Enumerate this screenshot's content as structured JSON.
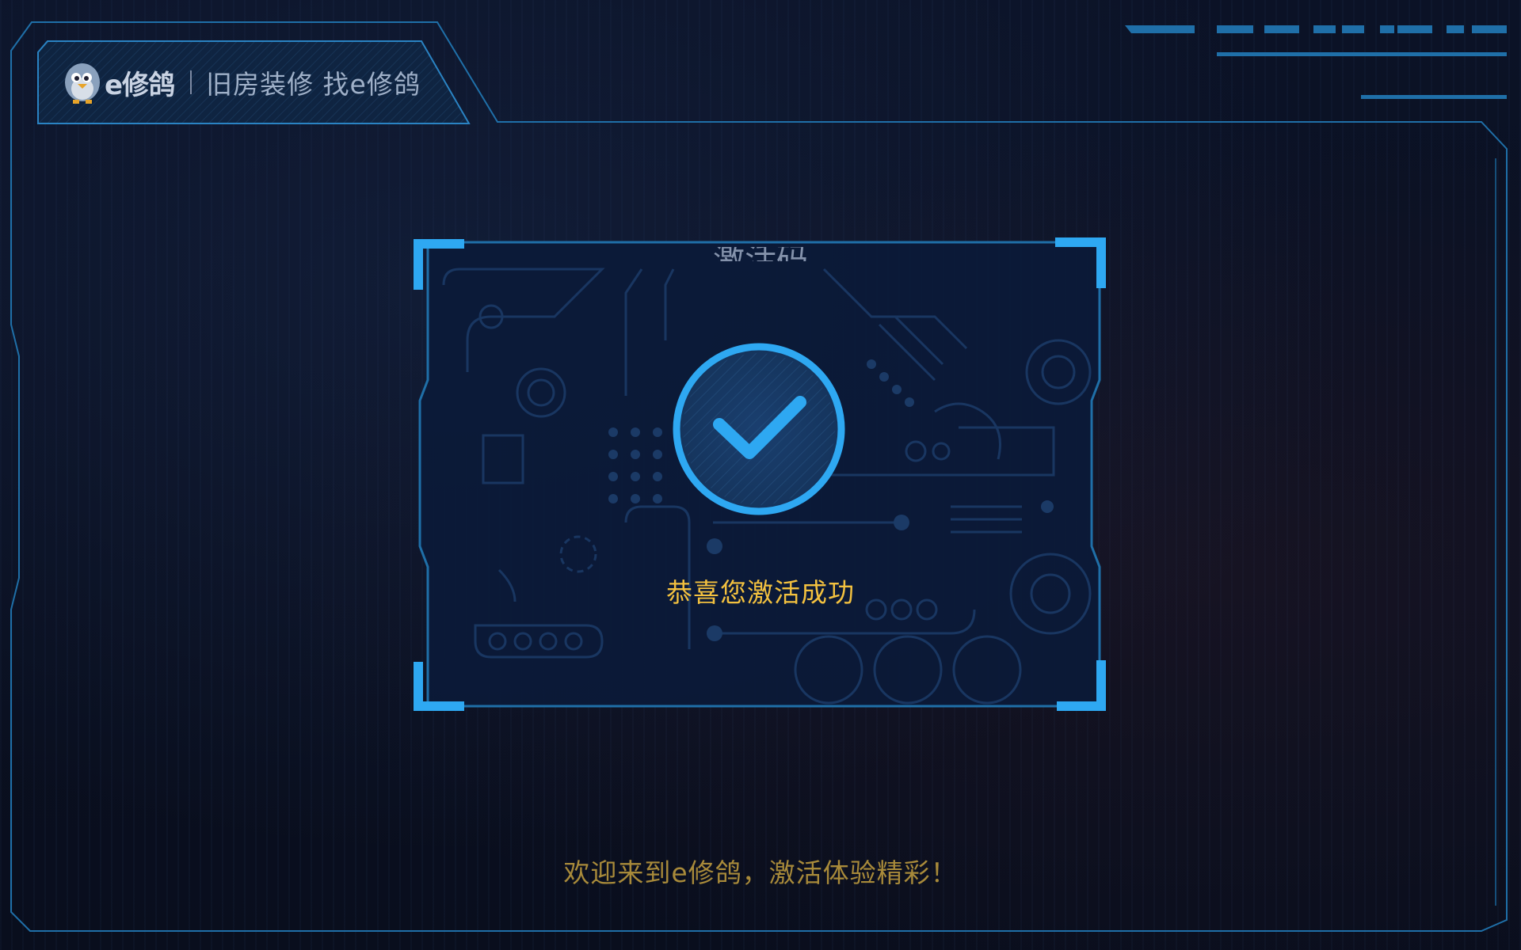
{
  "header": {
    "brand_name": "e修鸽",
    "slogan": "旧房装修 找e修鸽",
    "logo_icon": "pigeon-mascot-icon"
  },
  "dialog": {
    "title": "激活码",
    "status_icon": "check-circle-icon",
    "success_message": "恭喜您激活成功"
  },
  "footer": {
    "welcome_message": "欢迎来到e修鸽，激活体验精彩！"
  },
  "colors": {
    "background": "#0a1022",
    "frame_line": "#1f6fa8",
    "accent_blue": "#2ea8f2",
    "success_yellow": "#f3c13f",
    "welcome_gold": "#a88a3a"
  }
}
